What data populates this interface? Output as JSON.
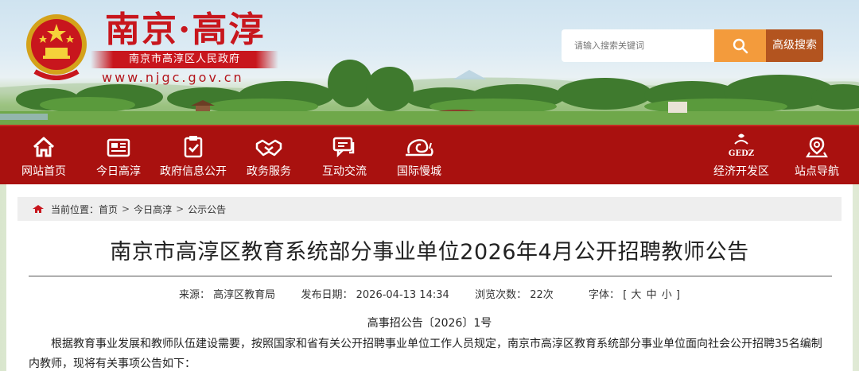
{
  "header": {
    "site_title": "南京·高淳",
    "gov_name": "南京市高淳区人民政府",
    "url": "www.njgc.gov.cn",
    "search_placeholder": "请输入搜索关键词",
    "advanced_search": "高级搜索",
    "brand_red": "#c8161d",
    "search_orange": "#f39b3c",
    "advanced_brown": "#b3541f"
  },
  "nav": {
    "bg_color": "#a9110f",
    "items": [
      {
        "label": "网站首页",
        "icon": "home-icon"
      },
      {
        "label": "今日高淳",
        "icon": "newspaper-icon"
      },
      {
        "label": "政府信息公开",
        "icon": "clipboard-check-icon"
      },
      {
        "label": "政务服务",
        "icon": "handshake-icon"
      },
      {
        "label": "互动交流",
        "icon": "chat-icon"
      },
      {
        "label": "国际慢城",
        "icon": "snail-icon"
      },
      {
        "label": "经济开发区",
        "icon": "gedz-logo-icon",
        "logo_text": "GEDZ"
      },
      {
        "label": "站点导航",
        "icon": "location-pin-icon"
      }
    ]
  },
  "breadcrumb": {
    "prefix": "当前位置：",
    "items": [
      "首页",
      "今日高淳",
      "公示公告"
    ],
    "separator": ">"
  },
  "article": {
    "title": "南京市高淳区教育系统部分事业单位2026年4月公开招聘教师公告",
    "source_label": "来源：",
    "source": "高淳区教育局",
    "date_label": "发布日期：",
    "date": "2026-04-13 14:34",
    "views_label": "浏览次数：",
    "views": "22次",
    "font_label": "字体：",
    "font_open": "[",
    "font_sizes": [
      "大",
      "中",
      "小"
    ],
    "font_close": "]",
    "doc_number": "高事招公告〔2026〕1号",
    "paragraph": "根据教育事业发展和教师队伍建设需要，按照国家和省有关公开招聘事业单位工作人员规定，南京市高淳区教育系统部分事业单位面向社会公开招聘35名编制内教师，现将有关事项公告如下："
  }
}
